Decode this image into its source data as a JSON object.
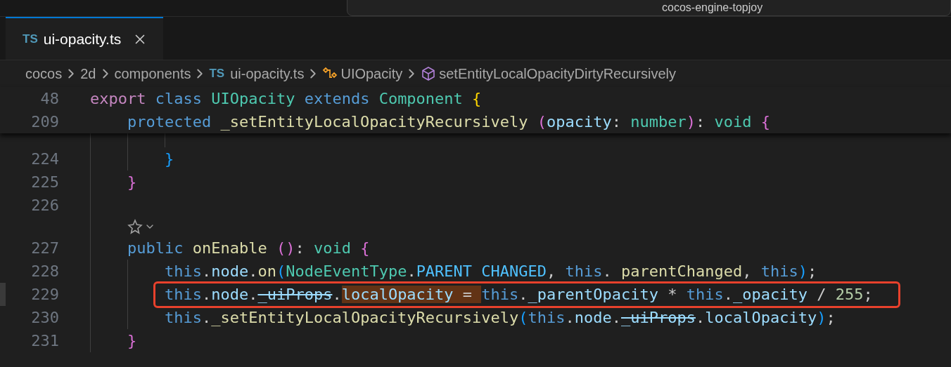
{
  "title_bar": {
    "search": {
      "value": "cocos-engine-topjoy"
    }
  },
  "tabs": [
    {
      "badge": "TS",
      "label": "ui-opacity.ts",
      "selected": true
    }
  ],
  "breadcrumb": [
    {
      "kind": "folder",
      "label": "cocos"
    },
    {
      "kind": "folder",
      "label": "2d"
    },
    {
      "kind": "folder",
      "label": "components"
    },
    {
      "kind": "file",
      "badge": "TS",
      "label": "ui-opacity.ts"
    },
    {
      "kind": "class",
      "label": "UIOpacity"
    },
    {
      "kind": "method",
      "label": "setEntityLocalOpacityDirtyRecursively"
    }
  ],
  "sticky_lines": [
    {
      "number": "48",
      "tokens": [
        {
          "text": "export",
          "kind": "kw"
        },
        {
          "text": " class",
          "kind": "storage"
        },
        {
          "text": " UIOpacity",
          "kind": "type"
        },
        {
          "text": " extends",
          "kind": "storage"
        },
        {
          "text": " Component",
          "kind": "type"
        },
        {
          "text": " {",
          "kind": "b1"
        }
      ]
    },
    {
      "number": "209",
      "tokens": [
        {
          "text": "    protected",
          "kind": "storage"
        },
        {
          "text": " _setEntityLocalOpacityRecursively",
          "kind": "fn"
        },
        {
          "text": " (",
          "kind": "b2"
        },
        {
          "text": "opacity",
          "kind": "var"
        },
        {
          "text": ":",
          "kind": "punct"
        },
        {
          "text": " number",
          "kind": "type"
        },
        {
          "text": ")",
          "kind": "b2"
        },
        {
          "text": ":",
          "kind": "punct"
        },
        {
          "text": " void",
          "kind": "type"
        },
        {
          "text": " {",
          "kind": "b2"
        }
      ]
    }
  ],
  "lines": [
    {
      "kind": "covered"
    },
    {
      "kind": "code",
      "number": "224",
      "current": false,
      "tokens": [
        {
          "text": "        }",
          "kind": "b3"
        }
      ]
    },
    {
      "kind": "code",
      "number": "225",
      "current": false,
      "tokens": [
        {
          "text": "    }",
          "kind": "b2"
        }
      ]
    },
    {
      "kind": "code",
      "number": "226",
      "current": false
    },
    {
      "kind": "codelens"
    },
    {
      "kind": "code",
      "number": "227",
      "current": false,
      "tokens": [
        {
          "text": "    public",
          "kind": "storage"
        },
        {
          "text": " onEnable",
          "kind": "fn"
        },
        {
          "text": " ()",
          "kind": "b2"
        },
        {
          "text": ":",
          "kind": "punct"
        },
        {
          "text": " void",
          "kind": "type"
        },
        {
          "text": " {",
          "kind": "b2"
        }
      ]
    },
    {
      "kind": "code",
      "number": "228",
      "current": false,
      "tokens": [
        {
          "text": "        this",
          "kind": "storage"
        },
        {
          "text": ".",
          "kind": "punct"
        },
        {
          "text": "node",
          "kind": "var"
        },
        {
          "text": ".",
          "kind": "punct"
        },
        {
          "text": "on",
          "kind": "fn"
        },
        {
          "text": "(",
          "kind": "b3"
        },
        {
          "text": "NodeEventType",
          "kind": "type"
        },
        {
          "text": ".",
          "kind": "punct"
        },
        {
          "text": "PARENT CHANGED",
          "kind": "const"
        },
        {
          "text": ",",
          "kind": "punct"
        },
        {
          "text": " this",
          "kind": "storage"
        },
        {
          "text": ". ",
          "kind": "punct"
        },
        {
          "text": "parentChanged",
          "kind": "fn"
        },
        {
          "text": ",",
          "kind": "punct"
        },
        {
          "text": " this",
          "kind": "storage"
        },
        {
          "text": ")",
          "kind": "b3"
        },
        {
          "text": ";",
          "kind": "punct"
        }
      ]
    },
    {
      "kind": "code",
      "number": "229",
      "current": true,
      "annotated": true,
      "tokens": [
        {
          "text": "        this",
          "kind": "storage",
          "selected": false
        },
        {
          "text": ".",
          "kind": "punct",
          "selected": false
        },
        {
          "text": "node",
          "kind": "var",
          "selected": false
        },
        {
          "text": ".",
          "kind": "punct",
          "selected": false
        },
        {
          "text": "_uiProps",
          "kind": "deprecated",
          "selected": false
        },
        {
          "text": ".",
          "kind": "punct",
          "selected": false
        },
        {
          "text": "localOpacity",
          "kind": "var",
          "selected": true
        },
        {
          "text": " = ",
          "kind": "punct",
          "selected": true
        },
        {
          "text": "this",
          "kind": "storage",
          "selected": false
        },
        {
          "text": ".",
          "kind": "punct",
          "selected": false
        },
        {
          "text": "_parentOpacity",
          "kind": "var",
          "selected": false
        },
        {
          "text": " * ",
          "kind": "punct",
          "selected": false
        },
        {
          "text": "this",
          "kind": "storage",
          "selected": false
        },
        {
          "text": ".",
          "kind": "punct",
          "selected": false
        },
        {
          "text": "_opacity",
          "kind": "var",
          "selected": false
        },
        {
          "text": " / ",
          "kind": "punct",
          "selected": false
        },
        {
          "text": "255",
          "kind": "num",
          "selected": false
        },
        {
          "text": ";",
          "kind": "punct",
          "selected": false
        }
      ]
    },
    {
      "kind": "code",
      "number": "230",
      "current": false,
      "tokens": [
        {
          "text": "        this",
          "kind": "storage"
        },
        {
          "text": ".",
          "kind": "punct"
        },
        {
          "text": "_setEntityLocalOpacityRecursively",
          "kind": "fn"
        },
        {
          "text": "(",
          "kind": "b3"
        },
        {
          "text": "this",
          "kind": "storage"
        },
        {
          "text": ".",
          "kind": "punct"
        },
        {
          "text": "node",
          "kind": "var"
        },
        {
          "text": ".",
          "kind": "punct"
        },
        {
          "text": "_uiProps",
          "kind": "deprecated"
        },
        {
          "text": ".",
          "kind": "punct"
        },
        {
          "text": "localOpacity",
          "kind": "var"
        },
        {
          "text": ")",
          "kind": "b3"
        },
        {
          "text": ";",
          "kind": "punct"
        }
      ]
    },
    {
      "kind": "code",
      "number": "231",
      "current": false,
      "tokens": [
        {
          "text": "    }",
          "kind": "b2"
        }
      ]
    }
  ]
}
